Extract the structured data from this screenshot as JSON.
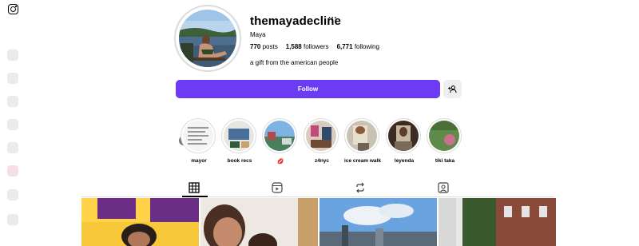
{
  "profile": {
    "username": "themayadecline",
    "more_label": "···",
    "full_name": "Maya",
    "bio": "a gift from the american people",
    "stats": {
      "posts_count": "770",
      "posts_label": "posts",
      "followers_count": "1,588",
      "followers_label": "followers",
      "following_count": "6,771",
      "following_label": "following"
    }
  },
  "actions": {
    "follow_label": "Follow",
    "suggest_icon": "add-person-icon"
  },
  "highlights": [
    {
      "label": "mayor"
    },
    {
      "label": "book recs"
    },
    {
      "label": "💋"
    },
    {
      "label": "z4nyc"
    },
    {
      "label": "ice cream walk"
    },
    {
      "label": "leyenda"
    },
    {
      "label": "tiki taka"
    }
  ],
  "tabs": [
    {
      "icon": "grid-icon",
      "active": true
    },
    {
      "icon": "reels-icon",
      "active": false
    },
    {
      "icon": "reposts-icon",
      "active": false
    },
    {
      "icon": "tagged-icon",
      "active": false
    }
  ],
  "colors": {
    "follow_button": "#6b3cf4",
    "secondary_button": "#efefef",
    "border": "#dbdbdb"
  }
}
